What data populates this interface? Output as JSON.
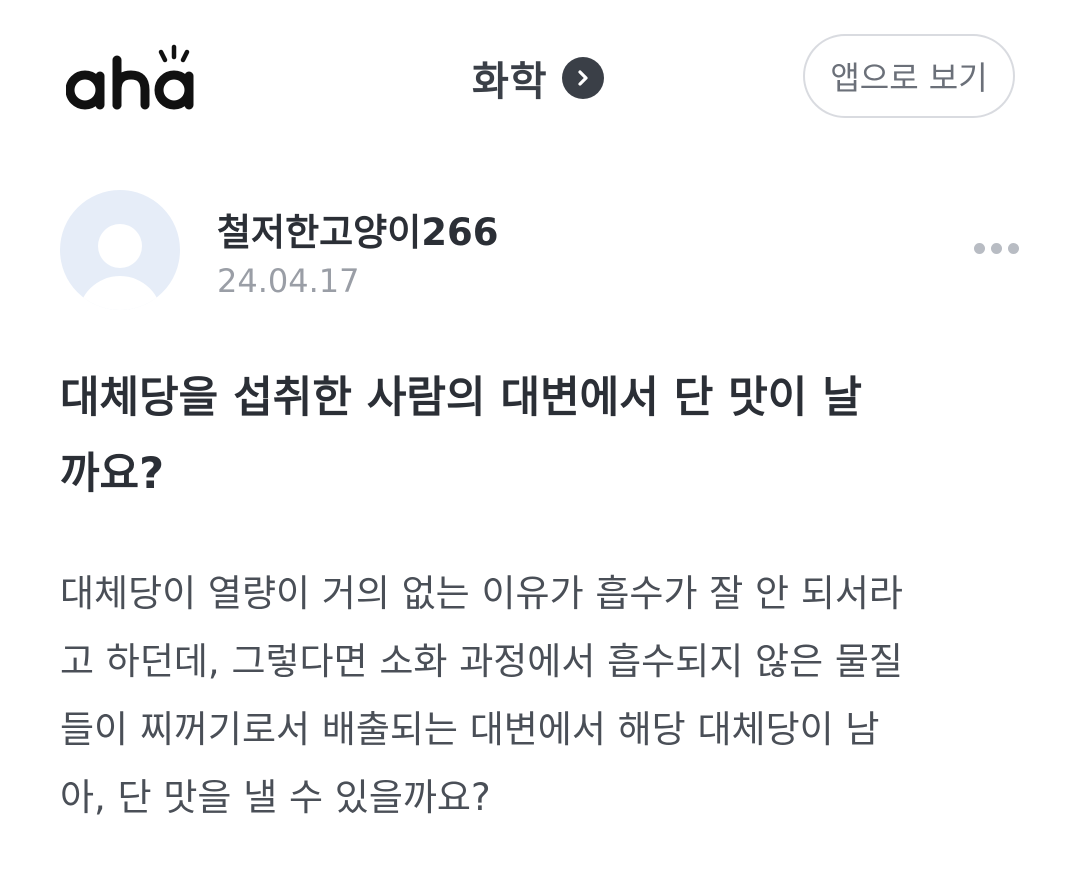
{
  "header": {
    "logo_text": "aha",
    "category": "화학",
    "app_button_label": "앱으로 보기"
  },
  "icons": {
    "logo": "aha-logo",
    "category_chevron": "chevron-right-icon",
    "avatar": "user-avatar-icon",
    "more": "more-horizontal-icon"
  },
  "colors": {
    "text_primary": "#2b2f36",
    "text_secondary": "#9a9ea6",
    "avatar_bg": "#e6edf8",
    "button_border": "#d9dbe0"
  },
  "author": {
    "name": "철저한고양이266",
    "date": "24.04.17"
  },
  "post": {
    "title_lines": [
      "대체당을 섭취한 사람의 대변에서 단 맛이 날",
      "까요?"
    ],
    "body_lines": [
      "대체당이 열량이 거의 없는 이유가 흡수가 잘 안 되서라",
      "고 하던데, 그렇다면 소화 과정에서 흡수되지 않은 물질",
      "들이 찌꺼기로서 배출되는 대변에서 해당 대체당이 남",
      "아, 단 맛을 낼 수 있을까요?"
    ]
  }
}
